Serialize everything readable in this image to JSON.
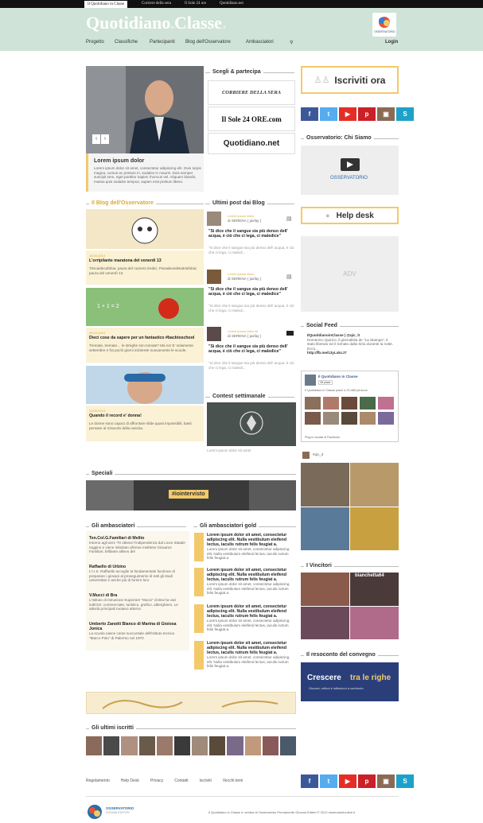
{
  "topbar": {
    "links": [
      "Il Quotidiano in Classe",
      "Corriere della sera",
      "Il Sole 24 ore",
      "Quotidiano.net"
    ]
  },
  "header": {
    "logo_main": "Quotidiano",
    "logo_in": "in",
    "logo_classe": "Classe",
    "logo_it": ".it",
    "badge": "OSSERVATORIO",
    "login": "Login"
  },
  "nav": [
    "Progetto",
    "Classifiche",
    "Partecipanti",
    "Blog dell'Osservatore",
    "Ambasciatori"
  ],
  "hero": {
    "title": "Lorem ipsum dolor",
    "text": "Lorem ipsum dolor sit amet, consectetur adipiscing elit. Duis turpis magna, cursus ac pretium in, sodales in mauris. Duis semper suscipit sem, eget porttitor sapien rhoncus vel. Aliquam blandit, massa quis sodales tempus, sapien erat pretium libero."
  },
  "scegli": {
    "heading": "Scegli & partecipa",
    "papers": [
      "CORRIERE DELLA SERA",
      "Il Sole 24 ORE.com",
      "Quotidiano.net"
    ]
  },
  "right": {
    "iscriviti": "Iscriviti ora",
    "chi_siamo": "Osservatorio: Chi Siamo",
    "osservatorio": "OSSERVATORIO",
    "helpdesk": "Help desk",
    "adv": "ADV",
    "social_feed": "Social Feed",
    "tweet_handle": "IlQuotidianoinClasse | @qic_it",
    "tweet_text": "Domenico Quirico, il giornalista de \"La Stampa\", è stato liberato ed è tornato dalla Siria durante la notte. Ecco...",
    "tweet_link": "http://fb.me/13yLxkcJ7",
    "fb_title": "Il Quotidiano in Classe",
    "fb_like": "Mi piace",
    "fb_count": "Il Quotidiano in Classe piace a 23.485 persone.",
    "fb_plugin": "Plug-in sociale di Facebook",
    "instagram": "#qic_it",
    "vincitori": "I Vincitori",
    "vincitore_name": "bianchetta64",
    "resoconto": "Il resoconto del convegno",
    "crescere": "Crescere",
    "tra_le_righe": "tra le righe",
    "crescere_sub": "Giovani, editori e istituzioni a confronto"
  },
  "blog": {
    "heading": "Il Blog dell'Osservatore",
    "posts": [
      {
        "date": "15.09.2013",
        "title": "L'orripilante maratona del venerdì 13",
        "text": "Triscaidecafobia: paura del numero tredici. Paraskevidekatriafobia: paura del venerdì 13."
      },
      {
        "date": "08.09.2013",
        "title": "Dieci cose da sapere per un fantastico #backtoschool",
        "text": "Tremate, tremate… le streghe son tornate? Ma no! E' solamente settembre e fra pochi giorni inizierete nuovamente le scuole."
      },
      {
        "date": "13.09.2013",
        "title": "Quando il record e' donna!",
        "text": "Le donne sono capaci di affrontare sfide quasi impossibili, basti pensare al miracolo della nascita."
      }
    ]
  },
  "ultimi_post": {
    "heading": "Ultimi post dai Blog",
    "posts": [
      {
        "date": "Lorem ipsum dolor",
        "author": "di SERENA ( jaxfay )",
        "quote": "\"Si dice che il sangue sia più denso dell' acqua, è ciò che ci lega, ci maledice\"",
        "text": "\"Si dice che il sangue sia più denso dell' acqua, è ciò che ci lega, ci maledi..."
      },
      {
        "date": "Lorem ipsum dolor",
        "author": "di SERENA ( jaxfay )",
        "quote": "\"Si dice che il sangue sia più denso dell' acqua, è ciò che ci lega, ci maledice\"",
        "text": "\"Si dice che il sangue sia più denso dell' acqua, è ciò che ci lega, ci maledi..."
      },
      {
        "date": "Lorem ipsum dolor sit",
        "author": "di SERENA ( jaxfay )",
        "quote": "\"Si dice che il sangue sia più denso dell' acqua, è ciò che ci lega, ci maledice\"",
        "text": "\"Si dice che il sangue sia più denso dell' acqua, è ciò che ci lega, ci maledi..."
      }
    ]
  },
  "contest": {
    "heading": "Contest settimanale",
    "caption": "Lorem ipsum dolor sit amet"
  },
  "speciali": {
    "heading": "Speciali",
    "tag": "#iointervisto"
  },
  "ambasciatori": {
    "heading": "Gli ambasciatori",
    "items": [
      {
        "title": "Ten.Col.G.Familiari di Melito",
        "text": "Intorno agli anni '70 ottiene l'indipendenza dal Liceo Statale reggino e viene intitolato all'eroe melitese Giovanni Familiari, brillante allievo del"
      },
      {
        "title": "Raffaello di Urbino",
        "text": "L'I.I.S. Raffaello accoglie la fondamentale funzione di preparare i giovani al proseguimento di tutti gli studi universitari e anche più di fornire loro"
      },
      {
        "title": "V.Mucci di Bra",
        "text": "L'Istituto di Istruzione Superiore \"Mucci\" di Bra ha vari indirizzi: commerciale, turistico, grafico, alberghiero. Le attività principali ruotano attorno"
      },
      {
        "title": "Umberto Zanotti Bianco di Marina di Gioiosa Jonica",
        "text": "La scuola nasce come succursale dell'istituto tecnico \"Marco Polo\" di Palermo nel 1970"
      }
    ]
  },
  "ambasciatori_gold": {
    "heading": "Gli ambasciatori gold",
    "text": "Lorem ipsum dolor sit amet, consectetur adipiscing elit. Nulla vestibulum eleifend lectus, iaculis rutrum felis feugiat a.",
    "text2": "Lorem ipsum dolor sit amet, consectetur adipiscing elit. Nulla vestibulum eleifend lectus, iaculis rutrum felis feugiat a."
  },
  "iscritti": {
    "heading": "Gli ultimi iscritti"
  },
  "footer": {
    "links": [
      "Regolamento",
      "Help Desk",
      "Privacy",
      "Contatti",
      "Iscriviti",
      "Vecchi temi"
    ],
    "badge": "OSSERVATORIO",
    "badge_sub": "GIOVANI-EDITORI",
    "copyright": "Il Quotidiano in Classe è un'idea di Osservatorio Permanente Giovani-Editori © 2012 osservatorionline.it"
  },
  "colors": {
    "header": "#cfe3d8",
    "accent": "#f3c96a",
    "facebook": "#3b5998",
    "twitter": "#55acee",
    "youtube": "#e52d27",
    "pinterest": "#cb2027",
    "instagram": "#8a6a55",
    "other": "#1da1c9"
  }
}
